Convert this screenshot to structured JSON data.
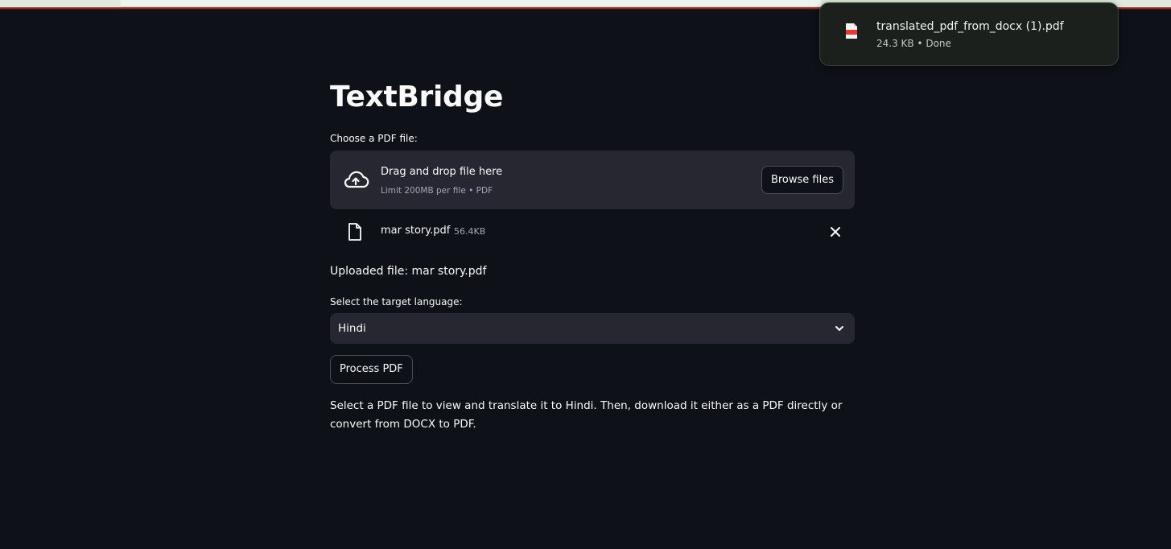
{
  "app": {
    "title": "TextBridge"
  },
  "uploader": {
    "label": "Choose a PDF file:",
    "drop_title": "Drag and drop file here",
    "drop_limit": "Limit 200MB per file • PDF",
    "browse_label": "Browse files",
    "file": {
      "name": "mar story.pdf",
      "size": "56.4KB"
    }
  },
  "uploaded_text": "Uploaded file: mar story.pdf",
  "language": {
    "label": "Select the target language:",
    "selected": "Hindi"
  },
  "process_label": "Process PDF",
  "info_text": "Select a PDF file to view and translate it to Hindi. Then, download it either as a PDF directly or convert from DOCX to PDF.",
  "download_popup": {
    "filename": "translated_pdf_from_docx (1).pdf",
    "status": "24.3 KB • Done"
  },
  "icons": {
    "upload": "cloud-upload-icon",
    "file": "file-icon",
    "remove": "close-icon",
    "dropdown": "chevron-down-icon",
    "pdf": "pdf-file-icon"
  },
  "colors": {
    "background": "#0e1117",
    "widget": "#262730",
    "popup": "#1c201c",
    "pdf_red": "#e53935"
  }
}
